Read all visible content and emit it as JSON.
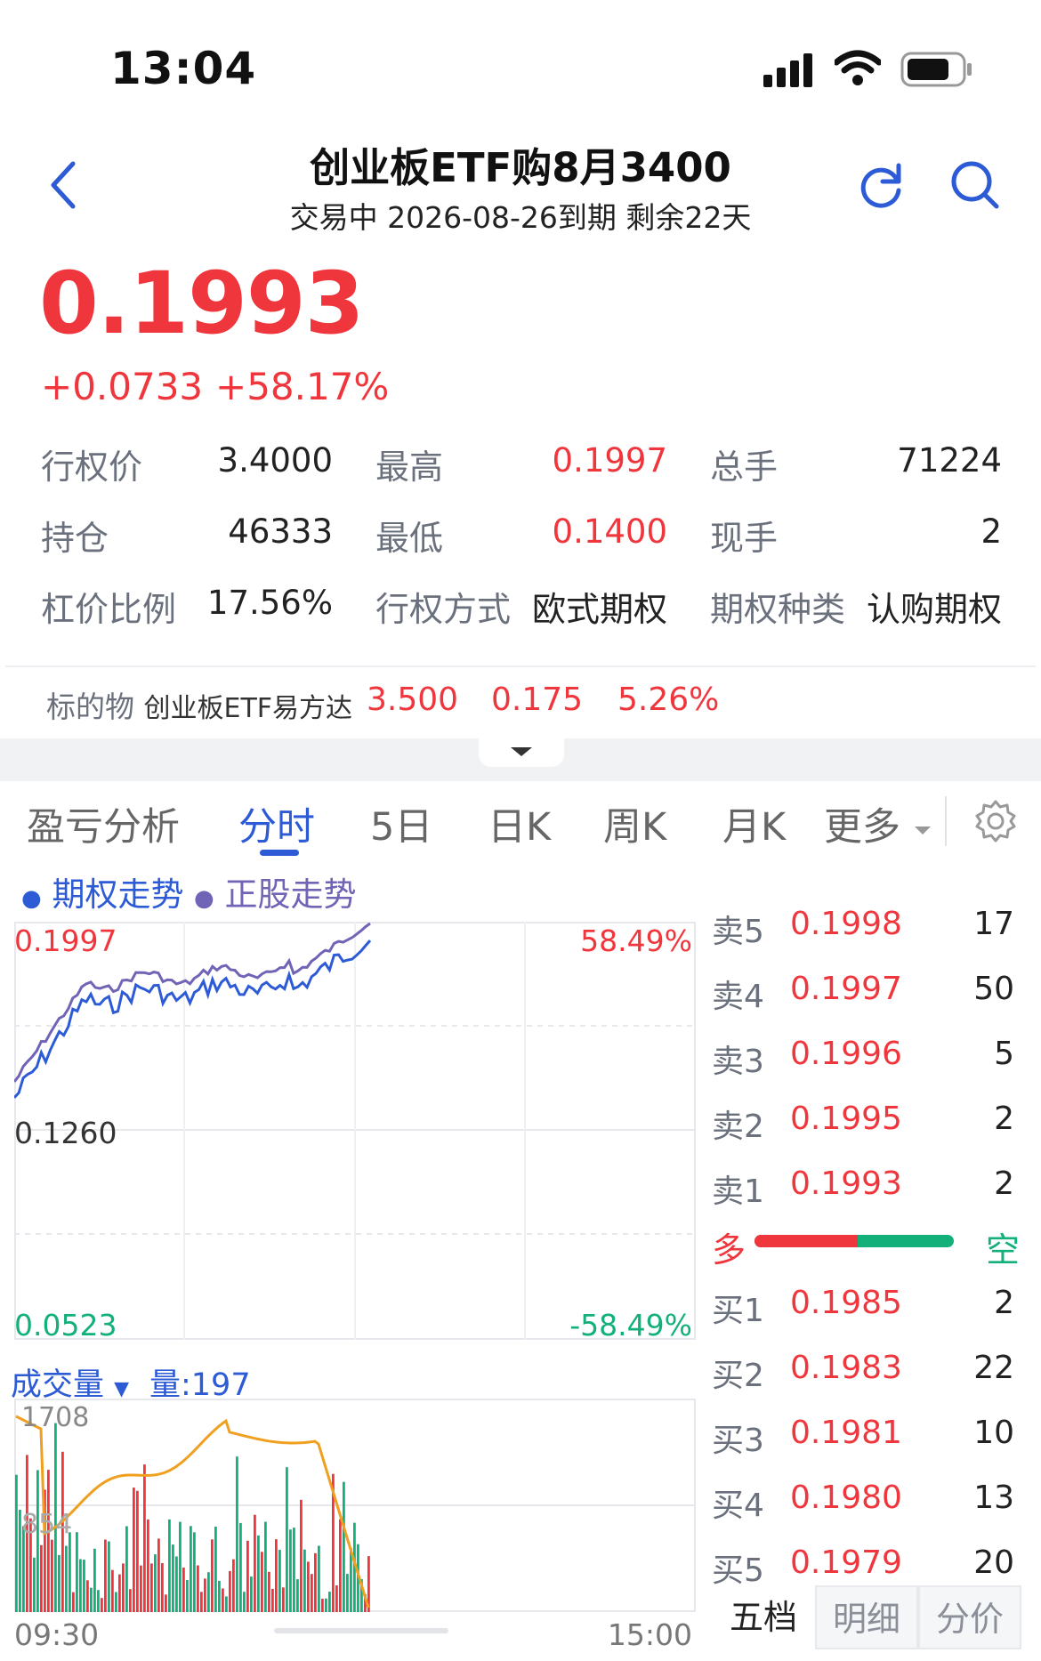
{
  "status": {
    "time": "13:04"
  },
  "header": {
    "title": "创业板ETF购8月3400",
    "subtitle": "交易中 2026-08-26到期 剩余22天"
  },
  "quote": {
    "price": "0.1993",
    "change": "+0.0733",
    "change_pct": "+58.17%"
  },
  "stats": [
    {
      "label": "行权价",
      "value": "3.4000"
    },
    {
      "label": "最高",
      "value": "0.1997"
    },
    {
      "label": "总手",
      "value": "71224"
    },
    {
      "label": "持仓",
      "value": "46333"
    },
    {
      "label": "最低",
      "value": "0.1400"
    },
    {
      "label": "现手",
      "value": "2"
    },
    {
      "label": "杠价比例",
      "value": "17.56%"
    },
    {
      "label": "行权方式",
      "value": "欧式期权"
    },
    {
      "label": "期权种类",
      "value": "认购期权"
    }
  ],
  "underlying": {
    "label": "标的物",
    "name": "创业板ETF易方达",
    "price": "3.500",
    "change": "0.175",
    "change_pct": "5.26%"
  },
  "tabs": [
    "盈亏分析",
    "分时",
    "5日",
    "日K",
    "周K",
    "月K",
    "更多"
  ],
  "active_tab": "分时",
  "legend": {
    "option": "期权走势",
    "stock": "正股走势"
  },
  "chart": {
    "y_max": "0.1997",
    "y_mid": "0.1260",
    "y_min": "0.0523",
    "pct_max": "58.49%",
    "pct_min": "-58.49%",
    "volume_title": "成交量",
    "volume_value": "量:197",
    "volume_max": "1708",
    "volume_mid": "854",
    "time_start": "09:30",
    "time_end": "15:00"
  },
  "order_book": {
    "asks": [
      {
        "label": "卖5",
        "price": "0.1998",
        "vol": "17"
      },
      {
        "label": "卖4",
        "price": "0.1997",
        "vol": "50"
      },
      {
        "label": "卖3",
        "price": "0.1996",
        "vol": "5"
      },
      {
        "label": "卖2",
        "price": "0.1995",
        "vol": "2"
      },
      {
        "label": "卖1",
        "price": "0.1993",
        "vol": "2"
      }
    ],
    "long_label": "多",
    "short_label": "空",
    "long_ratio": 0.52,
    "bids": [
      {
        "label": "买1",
        "price": "0.1985",
        "vol": "2"
      },
      {
        "label": "买2",
        "price": "0.1983",
        "vol": "22"
      },
      {
        "label": "买3",
        "price": "0.1981",
        "vol": "10"
      },
      {
        "label": "买4",
        "price": "0.1980",
        "vol": "13"
      },
      {
        "label": "买5",
        "price": "0.1979",
        "vol": "20"
      }
    ]
  },
  "bottom_tabs": [
    "五档",
    "明细",
    "分价"
  ],
  "colors": {
    "up": "#f0363d",
    "down": "#13b07a",
    "accent": "#2d5bd6",
    "stock_line": "#6f64b6",
    "avg_line": "#f0a020"
  }
}
